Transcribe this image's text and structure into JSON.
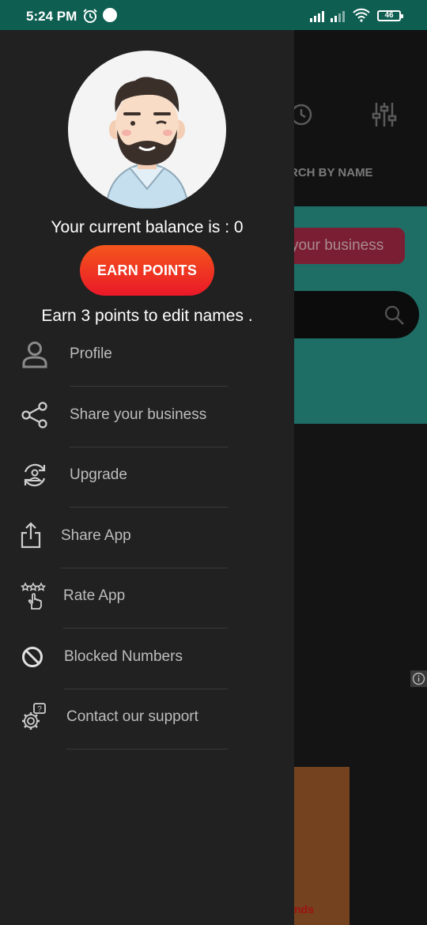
{
  "status_bar": {
    "time": "5:24 PM",
    "battery": "46",
    "icons": [
      "alarm-icon",
      "vpn-icon",
      "signal-icon",
      "signal-icon",
      "wifi-icon",
      "battery-icon"
    ]
  },
  "background": {
    "tab_label": "RCH BY NAME",
    "share_pill": "your business",
    "ad_text": "nds"
  },
  "drawer": {
    "balance_text": "Your current balance is : 0",
    "earn_button": "EARN POINTS",
    "earn_info": "Earn 3 points to edit names .",
    "menu": [
      {
        "label": "Profile",
        "icon": "person-icon"
      },
      {
        "label": "Share your business",
        "icon": "share-icon"
      },
      {
        "label": "Upgrade",
        "icon": "upgrade-icon"
      },
      {
        "label": "Share App",
        "icon": "export-icon"
      },
      {
        "label": "Rate App",
        "icon": "rate-icon"
      },
      {
        "label": "Blocked Numbers",
        "icon": "block-icon"
      },
      {
        "label": "Contact our support",
        "icon": "support-icon"
      }
    ]
  },
  "colors": {
    "status_bar": "#0e5f52",
    "drawer": "#212121",
    "earn_button_top": "#f4561c",
    "earn_button_bottom": "#ea1828",
    "banner": "#1f6e66"
  }
}
